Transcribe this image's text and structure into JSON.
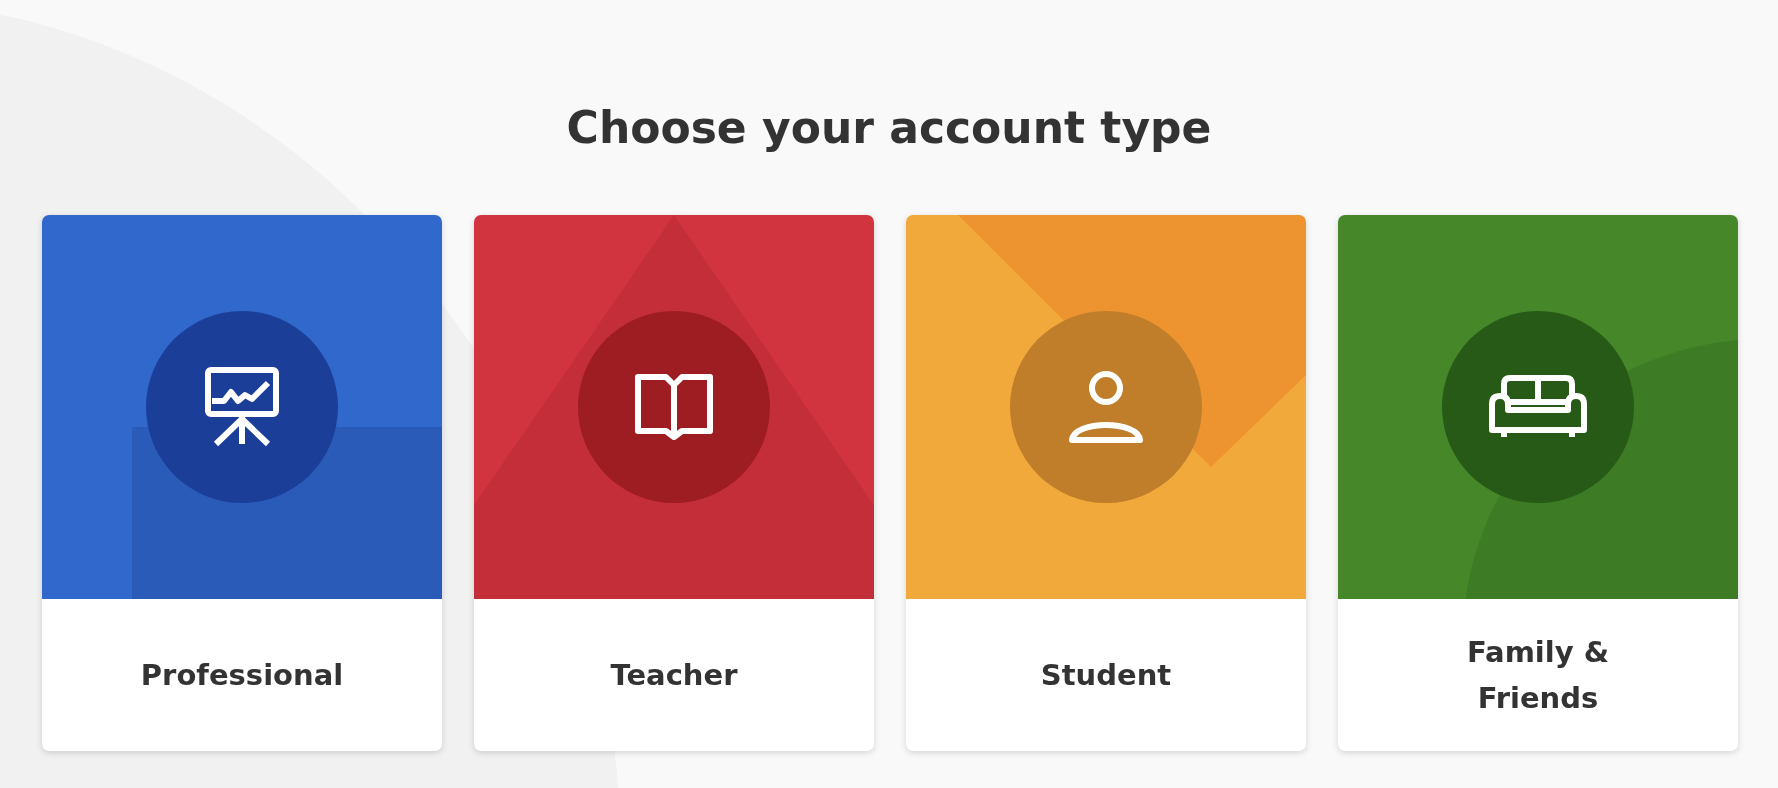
{
  "title": "Choose your account type",
  "cards": [
    {
      "kind": "presentation",
      "color": "#3068cc",
      "label_lines": [
        "Professional"
      ],
      "selected": false
    },
    {
      "kind": "book",
      "color": "#d2343f",
      "label_lines": [
        "Teacher"
      ],
      "selected": false
    },
    {
      "kind": "person",
      "color": "#f2a93b",
      "label_lines": [
        "Student"
      ],
      "selected": false
    },
    {
      "kind": "sofa",
      "color": "#468829",
      "label_lines": [
        "Family &",
        "Friends"
      ],
      "selected": false
    }
  ]
}
